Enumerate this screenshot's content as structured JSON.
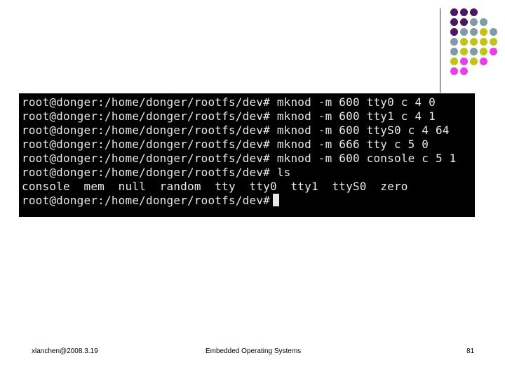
{
  "decoration": {
    "dot_colors": {
      "purple": "#4a1a5e",
      "teal": "#7f9ca6",
      "yellow": "#c2c21a",
      "magenta": "#e93ee9"
    },
    "dot_rows": [
      [
        "purple",
        "purple",
        "purple"
      ],
      [
        "purple",
        "purple",
        "teal",
        "teal"
      ],
      [
        "purple",
        "teal",
        "teal",
        "yellow",
        "teal"
      ],
      [
        "teal",
        "yellow",
        "yellow",
        "yellow",
        "yellow"
      ],
      [
        "teal",
        "yellow",
        "teal",
        "yellow",
        "magenta"
      ],
      [
        "yellow",
        "magenta",
        "yellow",
        "magenta"
      ],
      [
        "magenta",
        "magenta"
      ]
    ]
  },
  "terminal": {
    "lines": [
      "root@donger:/home/donger/rootfs/dev# mknod -m 600 tty0 c 4 0",
      "root@donger:/home/donger/rootfs/dev# mknod -m 600 tty1 c 4 1",
      "root@donger:/home/donger/rootfs/dev# mknod -m 600 ttyS0 c 4 64",
      "root@donger:/home/donger/rootfs/dev# mknod -m 666 tty c 5 0",
      "root@donger:/home/donger/rootfs/dev# mknod -m 600 console c 5 1",
      "root@donger:/home/donger/rootfs/dev# ls",
      "console  mem  null  random  tty  tty0  tty1  ttyS0  zero",
      "root@donger:/home/donger/rootfs/dev#"
    ]
  },
  "footer": {
    "author": "xlanchen@2008.3.19",
    "title": "Embedded Operating Systems",
    "page_number": "81"
  }
}
